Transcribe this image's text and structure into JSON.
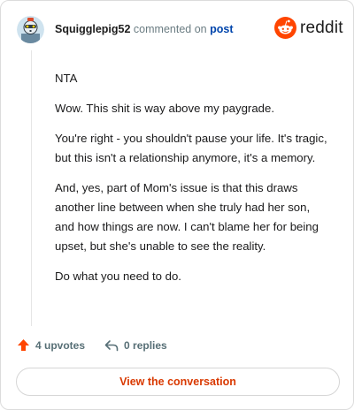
{
  "header": {
    "username": "Squigglepig52",
    "action_text": "commented on",
    "post_link": "post",
    "brand_name": "reddit"
  },
  "comment": {
    "paragraphs": [
      "NTA",
      "Wow. This shit is way above my paygrade.",
      "You're right - you shouldn't pause your life. It's tragic, but this isn't a relationship anymore, it's a memory.",
      "And, yes, part of Mom's issue is that this draws another line between when she truly had her son, and how things are now. I can't blame her for being upset, but she's unable to see the reality.",
      "Do what you need to do."
    ]
  },
  "actions": {
    "upvotes": "4 upvotes",
    "replies": "0 replies"
  },
  "footer": {
    "button_label": "View the conversation"
  },
  "colors": {
    "brand": "#ff4500",
    "link": "#0045ac",
    "button_text": "#d93900"
  },
  "icons": {
    "upvote": "upvote-arrow-icon",
    "reply": "reply-arrow-icon",
    "brand": "reddit-snoo-icon"
  }
}
